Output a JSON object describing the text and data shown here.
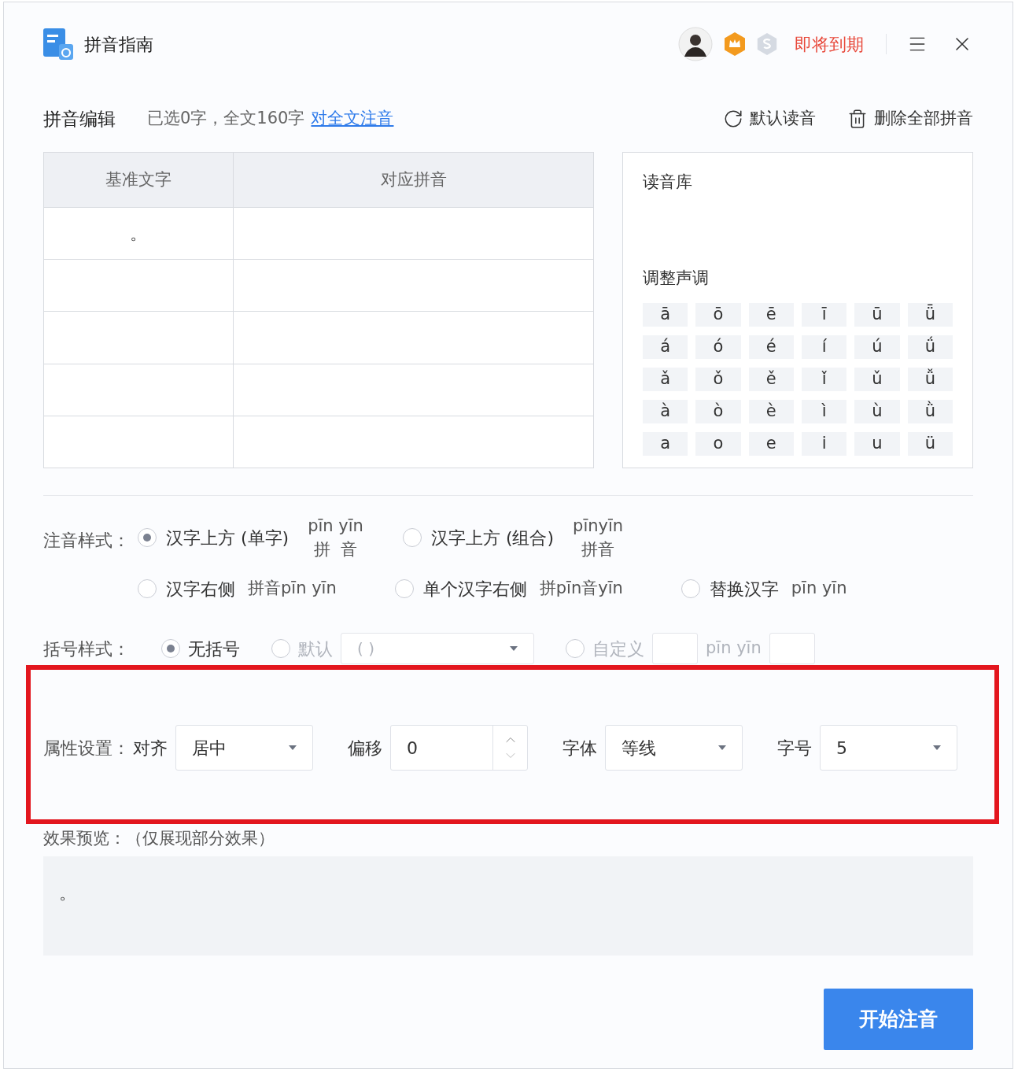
{
  "window": {
    "title": "拼音指南",
    "status": "即将到期"
  },
  "toolbar": {
    "title": "拼音编辑",
    "summary": "已选0字，全文160字",
    "link": "对全文注音",
    "actions": [
      "默认读音",
      "删除全部拼音"
    ]
  },
  "table": {
    "columns": [
      "基准文字",
      "对应拼音"
    ],
    "rows": [
      {
        "base": "。"
      }
    ]
  },
  "library": {
    "title": "读音库",
    "tone_title": "调整声调",
    "tones": [
      [
        "ā",
        "ō",
        "ē",
        "ī",
        "ū",
        "ǖ"
      ],
      [
        "á",
        "ó",
        "é",
        "í",
        "ú",
        "ǘ"
      ],
      [
        "ǎ",
        "ǒ",
        "ě",
        "ǐ",
        "ǔ",
        "ǚ"
      ],
      [
        "à",
        "ò",
        "è",
        "ì",
        "ù",
        "ǜ"
      ],
      [
        "a",
        "o",
        "e",
        "i",
        "u",
        "ü"
      ]
    ]
  },
  "annotation_style": {
    "label": "注音样式：",
    "options": [
      {
        "kind": "above",
        "label": "汉字上方 (单字)",
        "selected": true,
        "pinyin": "pīn yīn",
        "hanzi": "拼  音"
      },
      {
        "kind": "above",
        "label": "汉字上方 (组合)",
        "selected": false,
        "pinyin": "pīnyīn",
        "hanzi": "拼音"
      },
      {
        "kind": "inline",
        "label": "汉字右侧",
        "selected": false,
        "example": "拼音pīn yīn"
      },
      {
        "kind": "inline",
        "label": "单个汉字右侧",
        "selected": false,
        "example": "拼pīn音yīn"
      },
      {
        "kind": "inline",
        "label": "替换汉字",
        "selected": false,
        "example": "pīn yīn"
      }
    ]
  },
  "bracket_style": {
    "label": "括号样式：",
    "options": [
      {
        "kind": "plain",
        "label": "无括号",
        "selected": true
      },
      {
        "kind": "select",
        "label": "默认",
        "selected": false,
        "placeholder": "( )"
      },
      {
        "kind": "custom",
        "label": "自定义",
        "selected": false,
        "example": "pīn yīn"
      }
    ]
  },
  "properties": {
    "label": "属性设置：",
    "fields": [
      {
        "kind": "select",
        "label": "对齐",
        "value": "居中"
      },
      {
        "kind": "spinner",
        "label": "偏移",
        "value": "0"
      },
      {
        "kind": "select",
        "label": "字体",
        "value": "等线"
      },
      {
        "kind": "select",
        "label": "字号",
        "value": "5"
      }
    ]
  },
  "preview": {
    "label": "效果预览：（仅展现部分效果）",
    "text": "。"
  },
  "primary_button": "开始注音"
}
